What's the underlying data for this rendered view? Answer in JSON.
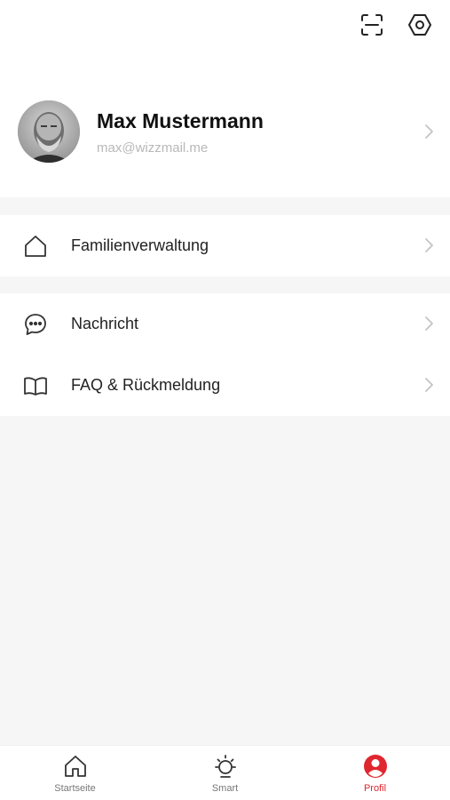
{
  "profile": {
    "name": "Max Mustermann",
    "email": "max@wizzmail.me"
  },
  "menu_group_1": [
    {
      "label": "Familienverwaltung",
      "icon": "home-outline-icon"
    }
  ],
  "menu_group_2": [
    {
      "label": "Nachricht",
      "icon": "message-bubble-icon"
    },
    {
      "label": "FAQ & Rückmeldung",
      "icon": "book-icon"
    }
  ],
  "tabs": [
    {
      "label": "Startseite",
      "icon": "home-icon",
      "active": false
    },
    {
      "label": "Smart",
      "icon": "sun-icon",
      "active": false
    },
    {
      "label": "Profil",
      "icon": "profile-icon",
      "active": true
    }
  ],
  "colors": {
    "accent": "#e0262f",
    "background": "#f6f6f6",
    "card": "#ffffff"
  }
}
